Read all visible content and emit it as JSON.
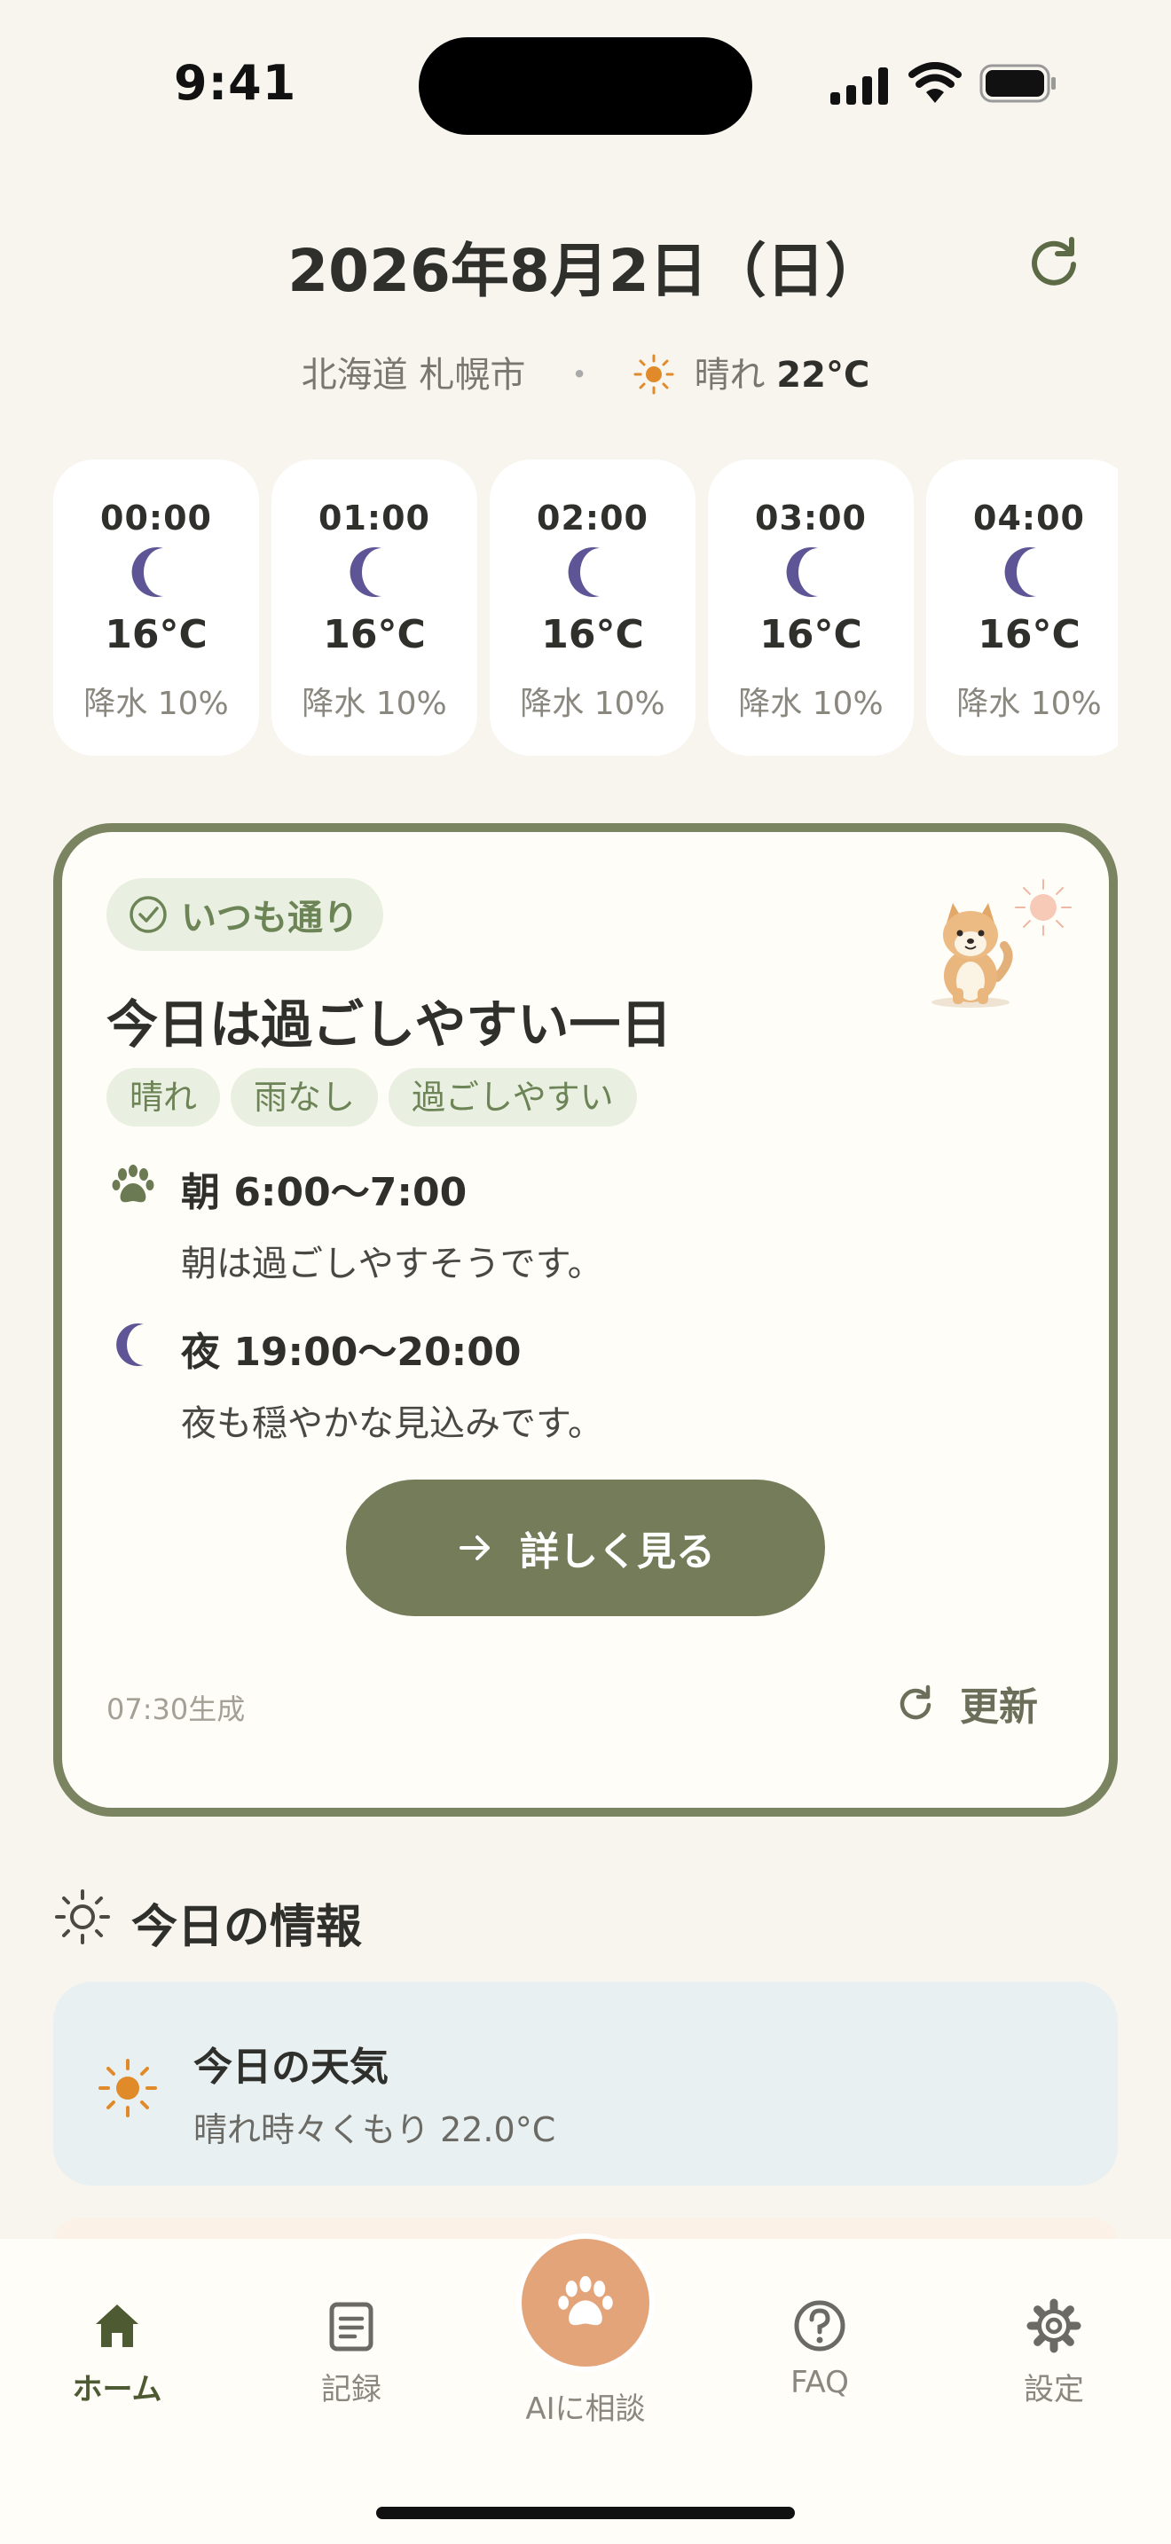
{
  "status_bar": {
    "time": "9:41"
  },
  "header": {
    "date": "2026年8月2日（日）",
    "location": "北海道 札幌市",
    "separator": "・",
    "weather": "晴れ",
    "temperature": "22°C"
  },
  "hourly": [
    {
      "time": "00:00",
      "icon": "moon-icon",
      "temp": "16°C",
      "rain": "降水 10%"
    },
    {
      "time": "01:00",
      "icon": "moon-icon",
      "temp": "16°C",
      "rain": "降水 10%"
    },
    {
      "time": "02:00",
      "icon": "moon-icon",
      "temp": "16°C",
      "rain": "降水 10%"
    },
    {
      "time": "03:00",
      "icon": "moon-icon",
      "temp": "16°C",
      "rain": "降水 10%"
    },
    {
      "time": "04:00",
      "icon": "moon-icon",
      "temp": "16°C",
      "rain": "降水 10%"
    }
  ],
  "main_card": {
    "badge": "いつも通り",
    "title": "今日は過ごしやすい一日",
    "tags": [
      "晴れ",
      "雨なし",
      "過ごしやすい"
    ],
    "morning": {
      "icon": "paw-icon",
      "title": "朝 6:00〜7:00",
      "desc": "朝は過ごしやすそうです。"
    },
    "night": {
      "icon": "moon-icon",
      "title": "夜 19:00〜20:00",
      "desc": "夜も穏やかな見込みです。"
    },
    "cta": "詳しく見る",
    "generated": "07:30生成",
    "update": "更新"
  },
  "today_info": {
    "title": "今日の情報",
    "weather_card": {
      "title": "今日の天気",
      "desc": "晴れ時々くもり 22.0°C"
    }
  },
  "tabbar": {
    "home": "ホーム",
    "records": "記録",
    "ai": "AIに相談",
    "faq": "FAQ",
    "settings": "設定"
  },
  "colors": {
    "accent": "#747c5a",
    "background": "#f8f5ef",
    "badge_bg": "#e9efe1",
    "moon": "#5e5596",
    "sun": "#e08a2a",
    "ai_button": "#e4a479"
  }
}
